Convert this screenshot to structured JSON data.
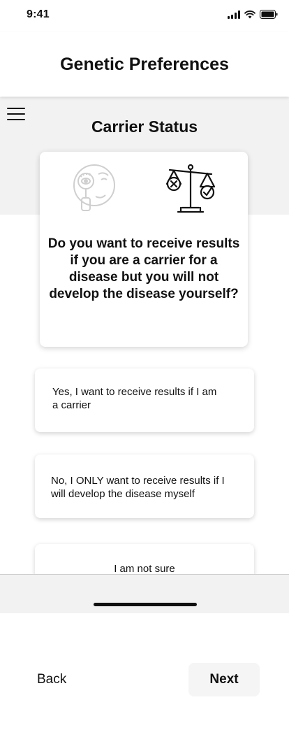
{
  "status_bar": {
    "time": "9:41",
    "icons": [
      "cellular-signal-icon",
      "wifi-icon",
      "battery-icon"
    ]
  },
  "header": {
    "title": "Genetic Preferences"
  },
  "menu": {
    "icon": "hamburger-menu-icon"
  },
  "section": {
    "title": "Carrier Status"
  },
  "question": {
    "text": "Do you want to receive results if you are a carrier for a disease but you will not develop the disease yourself?",
    "illustrations": [
      "magnifier-eye-face-icon",
      "balance-scale-icon"
    ]
  },
  "options": [
    {
      "label": "Yes, I want to receive results if I am a carrier"
    },
    {
      "label": "No, I ONLY want to receive results if I will develop the disease myself"
    },
    {
      "label": "I am not sure"
    }
  ],
  "footer": {
    "back_label": "Back",
    "next_label": "Next"
  },
  "colors": {
    "background": "#ffffff",
    "band": "#f2f2f2",
    "text": "#111111",
    "next_button_bg": "#f5f5f5",
    "illustration_faded": "#cfcfcf"
  }
}
